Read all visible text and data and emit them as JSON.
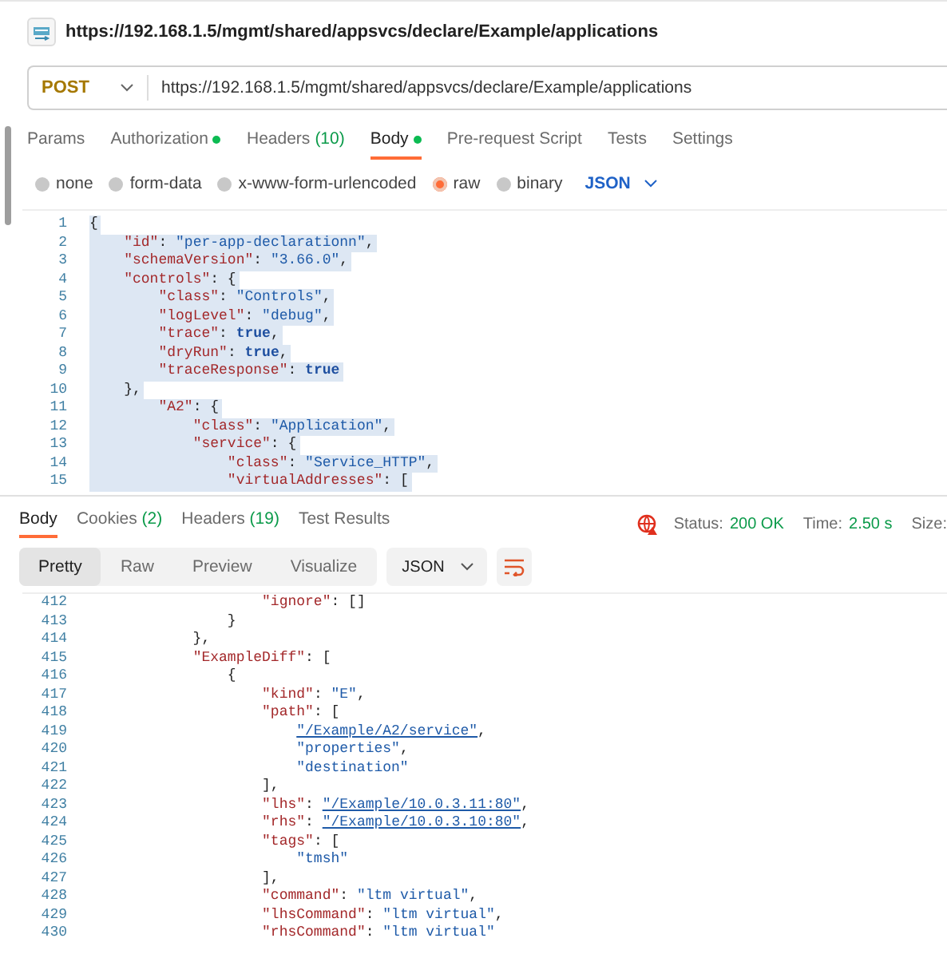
{
  "title": "https://192.168.1.5/mgmt/shared/appsvcs/declare/Example/applications",
  "request": {
    "method": "POST",
    "url": "https://192.168.1.5/mgmt/shared/appsvcs/declare/Example/applications"
  },
  "request_tabs": [
    {
      "label": "Params",
      "selected": false,
      "dot": false
    },
    {
      "label": "Authorization",
      "selected": false,
      "dot": true
    },
    {
      "label": "Headers",
      "count": "(10)",
      "selected": false,
      "dot": false
    },
    {
      "label": "Body",
      "selected": true,
      "dot": true
    },
    {
      "label": "Pre-request Script",
      "selected": false,
      "dot": false
    },
    {
      "label": "Tests",
      "selected": false,
      "dot": false
    },
    {
      "label": "Settings",
      "selected": false,
      "dot": false
    }
  ],
  "body_types": [
    {
      "label": "none",
      "selected": false
    },
    {
      "label": "form-data",
      "selected": false
    },
    {
      "label": "x-www-form-urlencoded",
      "selected": false
    },
    {
      "label": "raw",
      "selected": true
    },
    {
      "label": "binary",
      "selected": false
    }
  ],
  "body_format": "JSON",
  "request_body": {
    "highlighted": true,
    "lines": [
      {
        "num": "1",
        "text": "{"
      },
      {
        "num": "2",
        "text": "    \"id\": \"per-app-declarationn\","
      },
      {
        "num": "3",
        "text": "    \"schemaVersion\": \"3.66.0\","
      },
      {
        "num": "4",
        "text": "    \"controls\": {"
      },
      {
        "num": "5",
        "text": "        \"class\": \"Controls\","
      },
      {
        "num": "6",
        "text": "        \"logLevel\": \"debug\","
      },
      {
        "num": "7",
        "text": "        \"trace\": true,"
      },
      {
        "num": "8",
        "text": "        \"dryRun\": true,"
      },
      {
        "num": "9",
        "text": "        \"traceResponse\": true"
      },
      {
        "num": "10",
        "text": "    },"
      },
      {
        "num": "11",
        "text": "        \"A2\": {"
      },
      {
        "num": "12",
        "text": "            \"class\": \"Application\","
      },
      {
        "num": "13",
        "text": "            \"service\": {"
      },
      {
        "num": "14",
        "text": "                \"class\": \"Service_HTTP\","
      },
      {
        "num": "15",
        "text": "                \"virtualAddresses\": ["
      }
    ]
  },
  "response_tabs": [
    {
      "label": "Body",
      "selected": true
    },
    {
      "label": "Cookies",
      "count": "(2)",
      "selected": false
    },
    {
      "label": "Headers",
      "count": "(19)",
      "selected": false
    },
    {
      "label": "Test Results",
      "selected": false
    }
  ],
  "status": {
    "status_label": "Status:",
    "status_value": "200 OK",
    "time_label": "Time:",
    "time_value": "2.50 s",
    "size_label": "Size:"
  },
  "view_modes": [
    {
      "label": "Pretty",
      "selected": true
    },
    {
      "label": "Raw",
      "selected": false
    },
    {
      "label": "Preview",
      "selected": false
    },
    {
      "label": "Visualize",
      "selected": false
    }
  ],
  "response_format": "JSON",
  "response_body": {
    "lines": [
      {
        "num": "412",
        "text": "                    \"ignore\": []"
      },
      {
        "num": "413",
        "text": "                }"
      },
      {
        "num": "414",
        "text": "            },"
      },
      {
        "num": "415",
        "text": "            \"ExampleDiff\": ["
      },
      {
        "num": "416",
        "text": "                {"
      },
      {
        "num": "417",
        "text": "                    \"kind\": \"E\","
      },
      {
        "num": "418",
        "text": "                    \"path\": ["
      },
      {
        "num": "419",
        "text": "                        \"/Example/A2/service\","
      },
      {
        "num": "420",
        "text": "                        \"properties\","
      },
      {
        "num": "421",
        "text": "                        \"destination\""
      },
      {
        "num": "422",
        "text": "                    ],"
      },
      {
        "num": "423",
        "text": "                    \"lhs\": \"/Example/10.0.3.11:80\","
      },
      {
        "num": "424",
        "text": "                    \"rhs\": \"/Example/10.0.3.10:80\","
      },
      {
        "num": "425",
        "text": "                    \"tags\": ["
      },
      {
        "num": "426",
        "text": "                        \"tmsh\""
      },
      {
        "num": "427",
        "text": "                    ],"
      },
      {
        "num": "428",
        "text": "                    \"command\": \"ltm virtual\","
      },
      {
        "num": "429",
        "text": "                    \"lhsCommand\": \"ltm virtual\","
      },
      {
        "num": "430",
        "text": "                    \"rhsCommand\": \"ltm virtual\""
      }
    ]
  }
}
